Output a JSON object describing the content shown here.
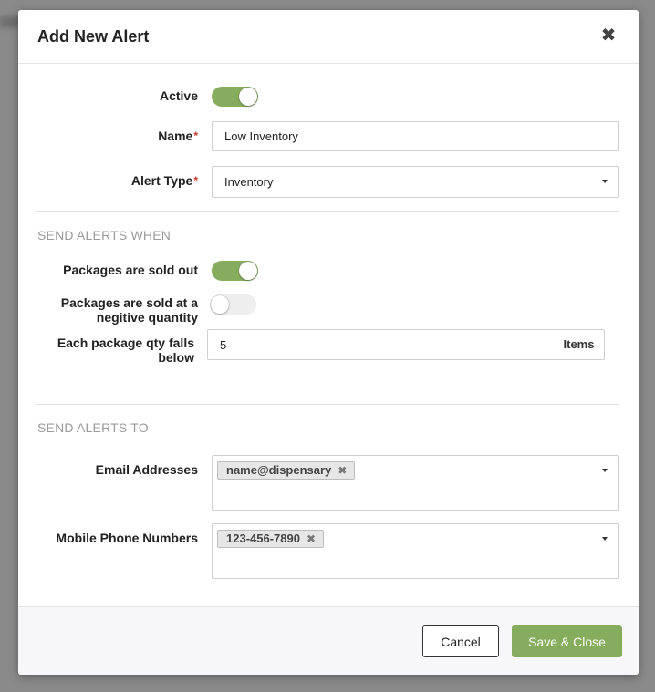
{
  "modal": {
    "title": "Add New Alert",
    "close_glyph": "✖"
  },
  "form": {
    "active": {
      "label": "Active",
      "on": true
    },
    "name": {
      "label": "Name",
      "required_mark": "*",
      "value": "Low Inventory"
    },
    "alert_type": {
      "label": "Alert Type",
      "required_mark": "*",
      "value": "Inventory"
    }
  },
  "send_alerts_when": {
    "title": "SEND ALERTS WHEN",
    "sold_out": {
      "label": "Packages are sold out",
      "on": true
    },
    "negative_qty": {
      "label_line1": "Packages are sold at a",
      "label_line2": "negitive quantity",
      "on": false
    },
    "qty_falls_below": {
      "label_line1": "Each package qty falls",
      "label_line2": "below",
      "value": "5",
      "unit": "Items"
    }
  },
  "send_alerts_to": {
    "title": "SEND ALERTS TO",
    "email": {
      "label": "Email Addresses",
      "chips": [
        "name@dispensary"
      ]
    },
    "phone": {
      "label": "Mobile Phone Numbers",
      "chips": [
        "123-456-7890"
      ]
    },
    "chip_remove_glyph": "✖"
  },
  "footer": {
    "cancel_label": "Cancel",
    "save_label": "Save & Close"
  },
  "colors": {
    "accent_green": "#86ad5e",
    "required_red": "#c0392b",
    "section_gray": "#9a9a9a"
  },
  "icons": {
    "close": "close-icon",
    "dropdown": "caret-down-icon",
    "chip_remove": "close-icon"
  }
}
